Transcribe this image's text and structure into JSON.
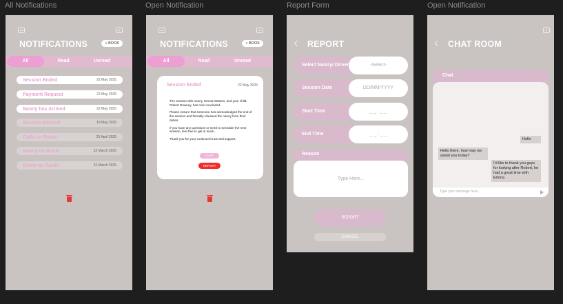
{
  "frames": [
    {
      "title": "All Notifications"
    },
    {
      "title": "Open Notification"
    },
    {
      "title": "Report Form"
    },
    {
      "title": "Open Notification"
    }
  ],
  "notifications_screen": {
    "header": "NOTIFICATIONS",
    "book_label": "+ BOOK",
    "tabs": [
      "All",
      "Read",
      "Unread"
    ],
    "items": [
      {
        "title": "Session Ended",
        "date": "22 May 2025"
      },
      {
        "title": "Payment Request",
        "date": "22 May 2025"
      },
      {
        "title": "Nanny has Arrived",
        "date": "22 May 2025"
      },
      {
        "title": "Session Booked",
        "date": "19 May 2025"
      },
      {
        "title": "Child on Route",
        "date": "25 April 2025"
      },
      {
        "title": "Nanny on Route",
        "date": "22 March 2025"
      },
      {
        "title": "Driver on Route",
        "date": "22 March 2025"
      }
    ]
  },
  "open_notification": {
    "header": "NOTIFICATIONS",
    "book_label": "+ BOOK",
    "tabs": [
      "All",
      "Read",
      "Unread"
    ],
    "title": "Session Ended",
    "date": "22 May 2025",
    "body": [
      "The session with nanny, Emma Watson, and your child, Robert Downey, has now concluded.",
      "Please ensure that someone has acknowledged the end of the session and formally released the nanny from their duties.",
      "If you have any questions or need to schedule the next session, feel free to get in touch.",
      "Thank you for your continued trust and support."
    ],
    "chat_label": "CHAT",
    "report_label": "REPORT"
  },
  "report_form": {
    "header": "REPORT",
    "fields": [
      {
        "label": "Select Nanny/ Driver",
        "value": "-Select-"
      },
      {
        "label": "Session Date",
        "value": "DD/MM/YYYY"
      },
      {
        "label": "Start Time",
        "value": "_ _ : _ _"
      },
      {
        "label": "End Time",
        "value": "_ _ : _ _"
      }
    ],
    "reason_label": "Reason",
    "reason_placeholder": "Type Here...",
    "submit_label": "REPORT",
    "cancel_label": "CANCEL"
  },
  "chat_room": {
    "header": "CHAT ROOM",
    "panel_title": "Chat",
    "messages": [
      {
        "text": "Hello"
      },
      {
        "text": "Hello there, how may we assist you today?"
      },
      {
        "text": "I'd like to thank you guys for looking after Robert, he had a great time with Emma"
      }
    ],
    "input_placeholder": "Type your message here..."
  },
  "colors": {
    "frame_bg": "#c9c3c1",
    "accent_pink": "#ed9fd3",
    "row_pink": "#d9b9cc",
    "danger_red": "#f32b2b"
  }
}
